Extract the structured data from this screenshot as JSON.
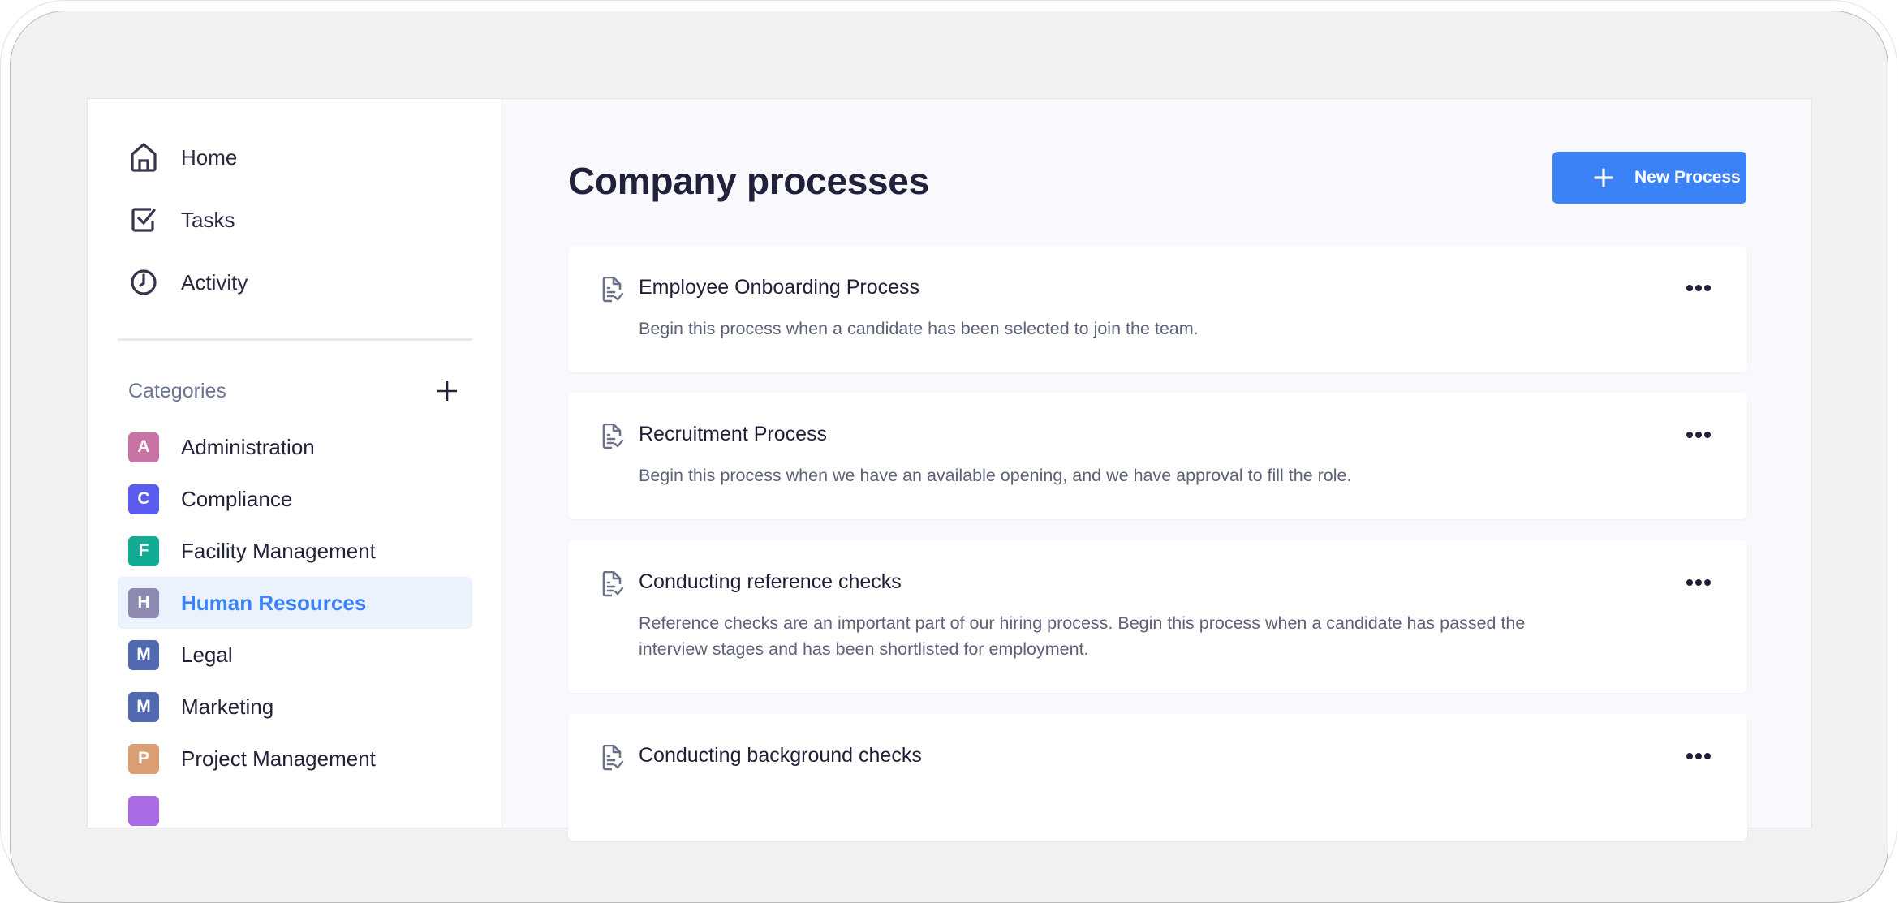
{
  "sidebar": {
    "nav": [
      {
        "label": "Home",
        "icon": "home-icon"
      },
      {
        "label": "Tasks",
        "icon": "checkbox-icon"
      },
      {
        "label": "Activity",
        "icon": "clock-icon"
      }
    ],
    "categories_title": "Categories",
    "categories": [
      {
        "letter": "A",
        "label": "Administration",
        "color": "#c972a5",
        "active": false
      },
      {
        "letter": "C",
        "label": "Compliance",
        "color": "#5b5bf0",
        "active": false
      },
      {
        "letter": "F",
        "label": "Facility Management",
        "color": "#13ab93",
        "active": false
      },
      {
        "letter": "H",
        "label": "Human Resources",
        "color": "#8c8aae",
        "active": true
      },
      {
        "letter": "M",
        "label": "Legal",
        "color": "#5069b0",
        "active": false
      },
      {
        "letter": "M",
        "label": "Marketing",
        "color": "#5069b0",
        "active": false
      },
      {
        "letter": "P",
        "label": "Project Management",
        "color": "#da9e72",
        "active": false
      },
      {
        "letter": "",
        "label": "",
        "color": "#a86be3",
        "active": false
      }
    ]
  },
  "main": {
    "title": "Company processes",
    "new_button_label": "New Process",
    "processes": [
      {
        "title": "Employee Onboarding Process",
        "description": "Begin this process when a candidate has been selected to join the team."
      },
      {
        "title": "Recruitment Process",
        "description": "Begin this process when we have an available opening, and we have approval to fill the role."
      },
      {
        "title": "Conducting reference checks",
        "description": "Reference checks are an important part of our hiring process. Begin this process when a candidate has passed the interview stages and has been shortlisted for employment."
      },
      {
        "title": "Conducting background checks",
        "description": ""
      }
    ]
  },
  "colors": {
    "accent": "#3b82f6",
    "active_bg": "#eaf2fe",
    "main_bg": "#f9f9fd",
    "text_dark": "#22223a",
    "text_muted": "#5d6278"
  }
}
